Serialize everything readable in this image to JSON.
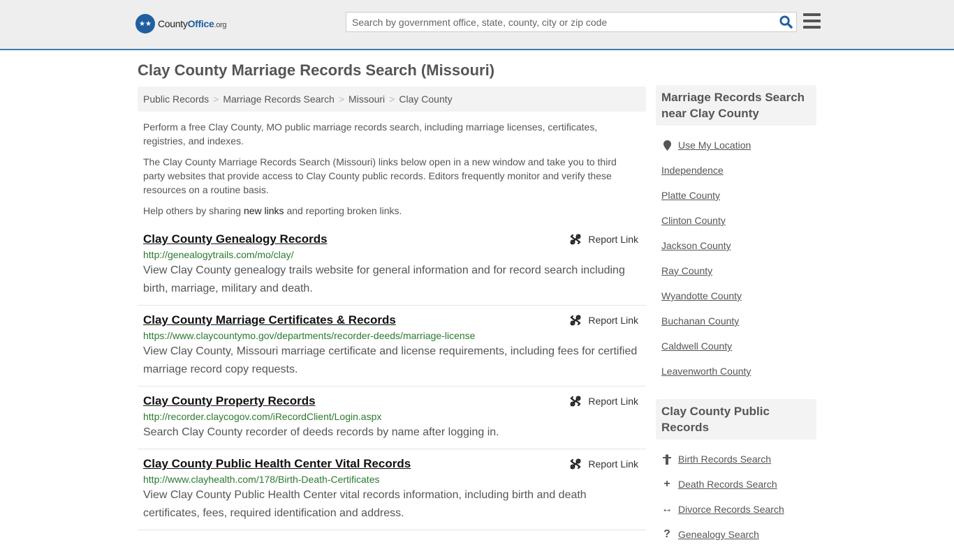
{
  "header": {
    "logo": {
      "part1": "County",
      "part2": "Office",
      "part3": ".org"
    },
    "search_placeholder": "Search by government office, state, county, city or zip code"
  },
  "page_title": "Clay County Marriage Records Search (Missouri)",
  "breadcrumb": [
    "Public Records",
    "Marriage Records Search",
    "Missouri",
    "Clay County"
  ],
  "intro": {
    "p1": "Perform a free Clay County, MO public marriage records search, including marriage licenses, certificates, registries, and indexes.",
    "p2": "The Clay County Marriage Records Search (Missouri) links below open in a new window and take you to third party websites that provide access to Clay County public records. Editors frequently monitor and verify these resources on a routine basis.",
    "p3_before": "Help others by sharing ",
    "p3_link": "new links",
    "p3_after": " and reporting broken links."
  },
  "report_label": "Report Link",
  "listings": [
    {
      "title": "Clay County Genealogy Records",
      "url": "http://genealogytrails.com/mo/clay/",
      "desc": "View Clay County genealogy trails website for general information and for record search including birth, marriage, military and death."
    },
    {
      "title": "Clay County Marriage Certificates & Records",
      "url": "https://www.claycountymo.gov/departments/recorder-deeds/marriage-license",
      "desc": "View Clay County, Missouri marriage certificate and license requirements, including fees for certified marriage record copy requests."
    },
    {
      "title": "Clay County Property Records",
      "url": "http://recorder.claycogov.com/iRecordClient/Login.aspx",
      "desc": "Search Clay County recorder of deeds records by name after logging in."
    },
    {
      "title": "Clay County Public Health Center Vital Records",
      "url": "http://www.clayhealth.com/178/Birth-Death-Certificates",
      "desc": "View Clay County Public Health Center vital records information, including birth and death certificates, fees, required identification and address."
    }
  ],
  "sidebar": {
    "nearby": {
      "heading": "Marriage Records Search near Clay County",
      "use_location": "Use My Location",
      "items": [
        "Independence",
        "Platte County",
        "Clinton County",
        "Jackson County",
        "Ray County",
        "Wyandotte County",
        "Buchanan County",
        "Caldwell County",
        "Leavenworth County"
      ]
    },
    "public_records": {
      "heading": "Clay County Public Records",
      "items": [
        {
          "label": "Birth Records Search",
          "icon": "child-icon"
        },
        {
          "label": "Death Records Search",
          "icon": "cross-icon"
        },
        {
          "label": "Divorce Records Search",
          "icon": "arrows-horizontal-icon"
        },
        {
          "label": "Genealogy Search",
          "icon": "question-icon"
        }
      ]
    }
  }
}
